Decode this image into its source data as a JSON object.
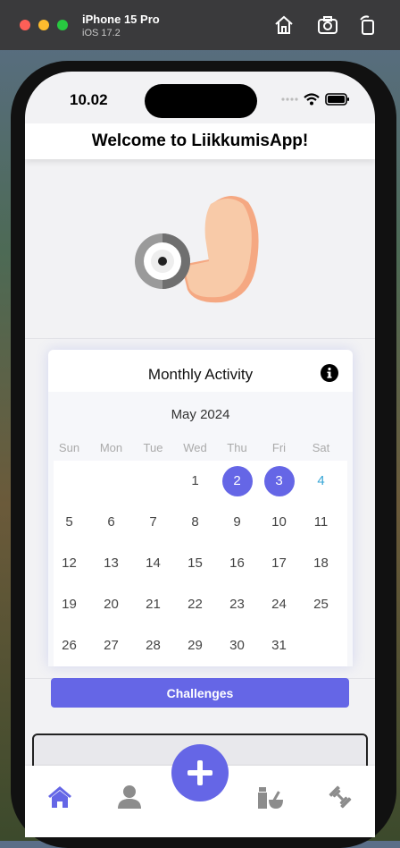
{
  "simulator": {
    "device": "iPhone 15 Pro",
    "os": "iOS 17.2"
  },
  "status_bar": {
    "time": "10.02"
  },
  "header": {
    "title": "Welcome to LiikkumisApp!"
  },
  "activity_card": {
    "title": "Monthly Activity",
    "month_label": "May 2024",
    "weekdays": [
      "Sun",
      "Mon",
      "Tue",
      "Wed",
      "Thu",
      "Fri",
      "Sat"
    ],
    "days": [
      "1",
      "2",
      "3",
      "4",
      "5",
      "6",
      "7",
      "8",
      "9",
      "10",
      "11",
      "12",
      "13",
      "14",
      "15",
      "16",
      "17",
      "18",
      "19",
      "20",
      "21",
      "22",
      "23",
      "24",
      "25",
      "26",
      "27",
      "28",
      "29",
      "30",
      "31"
    ],
    "first_weekday_index": 3,
    "selected_days": [
      "2",
      "3"
    ],
    "today": "4",
    "selected_color": "#6566e6",
    "today_color": "#36a5d6"
  },
  "challenges_button": {
    "label": "Challenges"
  },
  "accent_color": "#6566e6",
  "tabbar": {
    "items": [
      "home-icon",
      "profile-icon",
      "add-icon",
      "supplements-icon",
      "dumbbell-icon"
    ],
    "active": "home-icon"
  }
}
